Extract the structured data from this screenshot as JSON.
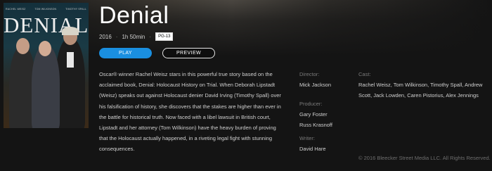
{
  "movie": {
    "title": "Denial",
    "year": "2016",
    "duration": "1h 50min",
    "rating": "PG-13",
    "description": "Oscar® winner Rachel Weisz stars in this powerful true story based on the acclaimed book, Denial: Holocaust History on Trial. When Deborah Lipstadt (Weisz) speaks out against Holocaust denier David Irving (Timothy Spall) over his falsification of history, she discovers that the stakes are higher than ever in the battle for historical truth. Now faced with a libel lawsuit in British court, Lipstadt and her attorney (Tom Wilkinson) have the heavy burden of proving that the Holocaust actually happened, in a riveting legal fight with stunning consequences."
  },
  "poster": {
    "names": [
      "RACHEL WEISZ",
      "TOM WILKINSON",
      "TIMOTHY SPALL"
    ],
    "title": "DENIAL"
  },
  "actions": {
    "play_label": "PLAY",
    "preview_label": "PREVIEW"
  },
  "credits": {
    "director_label": "Director:",
    "director": "Mick Jackson",
    "producer_label": "Producer:",
    "producers": [
      "Gary Foster",
      "Russ Krasnoff"
    ],
    "writer_label": "Writer:",
    "writer": "David Hare",
    "cast_label": "Cast:",
    "cast": "Rachel Weisz, Tom Wilkinson, Timothy Spall, Andrew Scott, Jack Lowden, Caren Pistorius, Alex Jennings"
  },
  "copyright": "© 2016 Bleecker Street Media LLC. All Rights Reserved.",
  "colors": {
    "accent": "#1a8fe0",
    "background": "#141414"
  }
}
